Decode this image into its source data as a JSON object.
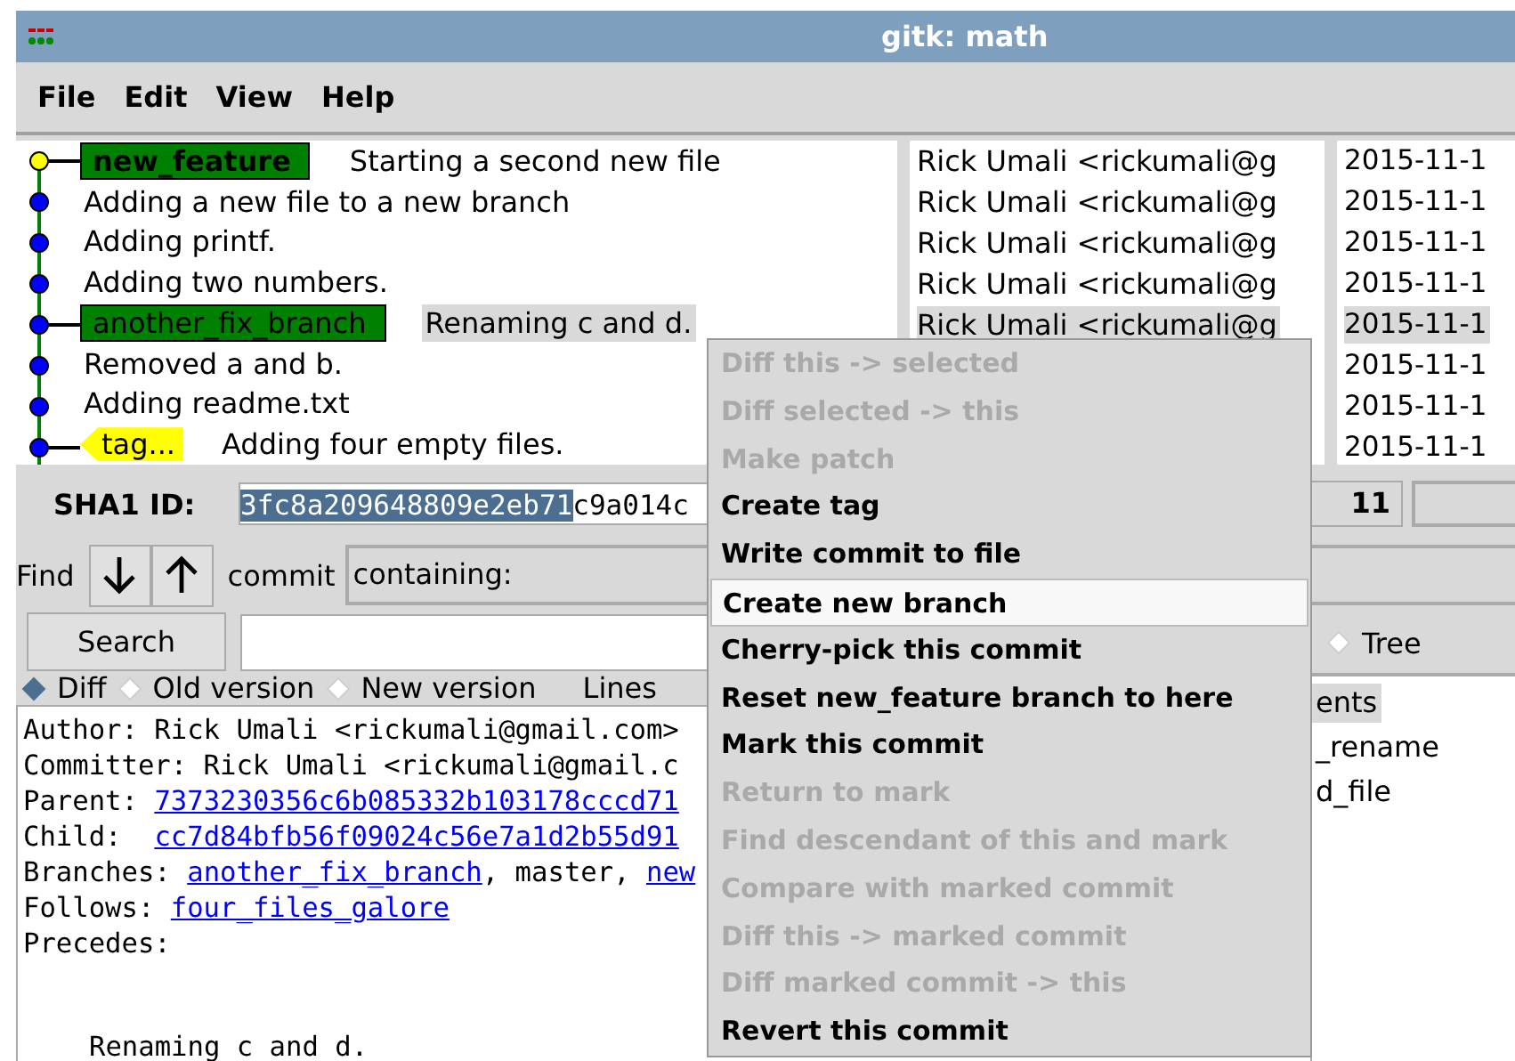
{
  "window": {
    "title": "gitk: math"
  },
  "menu_bar": [
    "File",
    "Edit",
    "View",
    "Help"
  ],
  "commits": [
    {
      "subject": "Starting a second new file",
      "color": "#ffff00",
      "selected": false,
      "refs": [
        {
          "kind": "head",
          "label": "new_feature"
        }
      ]
    },
    {
      "subject": "Adding a new file to a new branch",
      "color": "#0000ff",
      "selected": false
    },
    {
      "subject": "Adding printf.",
      "color": "#0000ff",
      "selected": false
    },
    {
      "subject": "Adding two numbers.",
      "color": "#0000ff",
      "selected": false
    },
    {
      "subject": "Renaming c and d.",
      "color": "#0000ff",
      "selected": true,
      "refs": [
        {
          "kind": "branch",
          "label": "another_fix_branch"
        }
      ]
    },
    {
      "subject": "Removed a and b.",
      "color": "#0000ff",
      "selected": false
    },
    {
      "subject": "Adding readme.txt",
      "color": "#0000ff",
      "selected": false
    },
    {
      "subject": "Adding four empty files.",
      "color": "#0000ff",
      "selected": false,
      "refs": [
        {
          "kind": "tag",
          "label": "tag..."
        }
      ]
    }
  ],
  "authors": [
    {
      "text": "Rick Umali <rickumali@g",
      "selected": false
    },
    {
      "text": "Rick Umali <rickumali@g",
      "selected": false
    },
    {
      "text": "Rick Umali <rickumali@g",
      "selected": false
    },
    {
      "text": "Rick Umali <rickumali@g",
      "selected": false
    },
    {
      "text": "Rick Umali <rickumali@g",
      "selected": true
    }
  ],
  "dates": [
    {
      "text": "2015-11-1",
      "selected": false
    },
    {
      "text": "2015-11-1",
      "selected": false
    },
    {
      "text": "2015-11-1",
      "selected": false
    },
    {
      "text": "2015-11-1",
      "selected": false
    },
    {
      "text": "2015-11-1",
      "selected": true
    },
    {
      "text": "2015-11-1",
      "selected": false
    },
    {
      "text": "2015-11-1",
      "selected": false
    },
    {
      "text": "2015-11-1",
      "selected": false
    }
  ],
  "sha1": {
    "label": "SHA1 ID:",
    "selected_part": "3fc8a209648809e2eb71",
    "rest": "c9a014c"
  },
  "row_count": "11",
  "find": {
    "label": "Find",
    "scope": "commit",
    "mode": "containing:"
  },
  "search_button": "Search",
  "diff_views": [
    {
      "label": "Diff",
      "selected": true
    },
    {
      "label": "Old version",
      "selected": false
    },
    {
      "label": "New version",
      "selected": false
    }
  ],
  "lines_label": "Lines",
  "file_views": [
    {
      "label": "Tree",
      "selected": false
    }
  ],
  "details": [
    [
      {
        "kind": "text",
        "text": "Author: Rick Umali <rickumali@gmail.com>"
      }
    ],
    [
      {
        "kind": "text",
        "text": "Committer: Rick Umali <rickumali@gmail.c"
      }
    ],
    [
      {
        "kind": "text",
        "text": "Parent: "
      },
      {
        "kind": "link",
        "text": "7373230356c6b085332b103178cccd71"
      }
    ],
    [
      {
        "kind": "text",
        "text": "Child:  "
      },
      {
        "kind": "link",
        "text": "cc7d84bfb56f09024c56e7a1d2b55d91"
      }
    ],
    [
      {
        "kind": "text",
        "text": "Branches: "
      },
      {
        "kind": "link",
        "text": "another_fix_branch"
      },
      {
        "kind": "text",
        "text": ", master, "
      },
      {
        "kind": "link",
        "text": "new"
      }
    ],
    [
      {
        "kind": "text",
        "text": "Follows: "
      },
      {
        "kind": "link",
        "text": "four_files_galore"
      }
    ],
    [
      {
        "kind": "text",
        "text": "Precedes:"
      }
    ]
  ],
  "commit_message": "Renaming c and d.",
  "files": [
    {
      "label": "ents",
      "selected": true
    },
    {
      "label": "_rename",
      "selected": false
    },
    {
      "label": "d_file",
      "selected": false
    }
  ],
  "context_menu": [
    {
      "label": "Diff this -> selected",
      "disabled": true,
      "selected": false
    },
    {
      "label": "Diff selected -> this",
      "disabled": true,
      "selected": false
    },
    {
      "label": "Make patch",
      "disabled": true,
      "selected": false
    },
    {
      "label": "Create tag",
      "disabled": false,
      "selected": false
    },
    {
      "label": "Write commit to file",
      "disabled": false,
      "selected": false
    },
    {
      "label": "Create new branch",
      "disabled": false,
      "selected": true
    },
    {
      "label": "Cherry-pick this commit",
      "disabled": false,
      "selected": false
    },
    {
      "label": "Reset new_feature branch to here",
      "disabled": false,
      "selected": false
    },
    {
      "label": "Mark this commit",
      "disabled": false,
      "selected": false
    },
    {
      "label": "Return to mark",
      "disabled": true,
      "selected": false
    },
    {
      "label": "Find descendant of this and mark",
      "disabled": true,
      "selected": false
    },
    {
      "label": "Compare with marked commit",
      "disabled": true,
      "selected": false
    },
    {
      "label": "Diff this -> marked commit",
      "disabled": true,
      "selected": false
    },
    {
      "label": "Diff marked commit -> this",
      "disabled": true,
      "selected": false
    },
    {
      "label": "Revert this commit",
      "disabled": false,
      "selected": false
    }
  ]
}
